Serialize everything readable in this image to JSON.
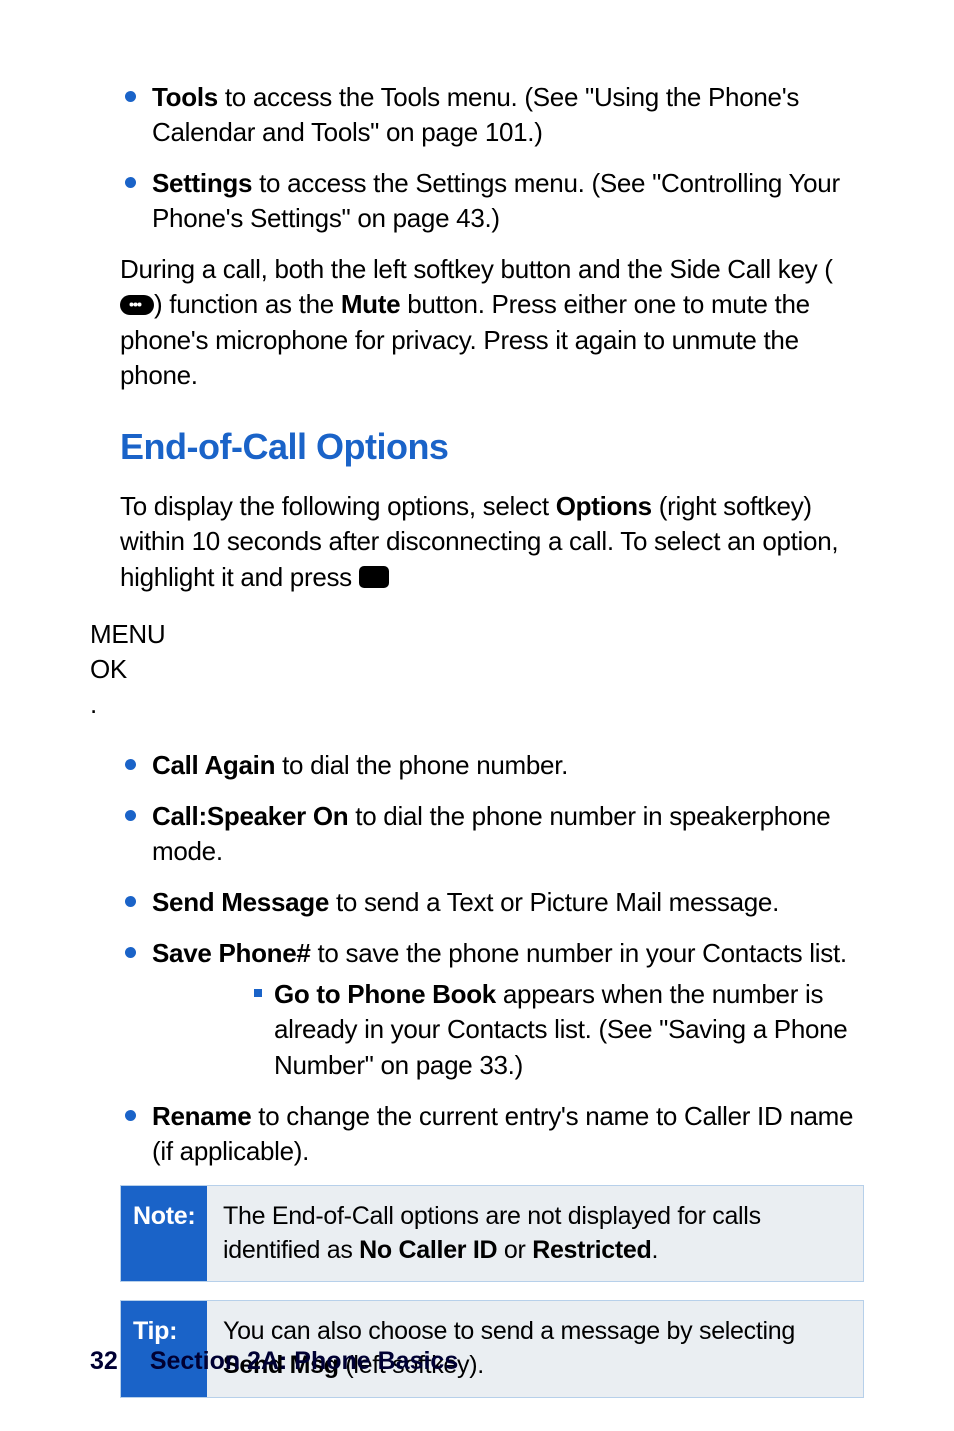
{
  "top_list": [
    {
      "title": "Tools",
      "text": " to access the Tools menu. (See \"Using the Phone's Calendar and Tools\" on page 101.)"
    },
    {
      "title": "Settings",
      "text": " to access the Settings menu. (See \"Controlling Your Phone's Settings\" on page 43.)"
    }
  ],
  "during_call": {
    "pre": "During a call, both the left softkey button and the Side Call key (",
    "post_icon": ") function as the ",
    "bold": "Mute",
    "tail": " button. Press either one to mute the phone's microphone for privacy. Press it again to unmute the phone."
  },
  "heading": "End-of-Call Options",
  "intro": {
    "pre": "To display the following options, select ",
    "options": "Options",
    "mid": " (right softkey) within 10 seconds after disconnecting a call. To select an option, highlight it and press ",
    "tail": "."
  },
  "options_list": [
    {
      "title": "Call Again",
      "text": " to dial the phone number."
    },
    {
      "title": "Call:Speaker On",
      "text": " to dial the phone number in speakerphone mode."
    },
    {
      "title": "Send Message",
      "text": " to send a Text or Picture Mail message."
    },
    {
      "title": "Save Phone#",
      "text": " to save the phone number in your Contacts list.",
      "sub": [
        {
          "title": "Go to Phone Book",
          "text": " appears when the number is already in your Contacts list. (See \"Saving a Phone Number\" on page 33.)"
        }
      ]
    },
    {
      "title": "Rename",
      "text": " to change the current entry's name to Caller ID name (if applicable)."
    }
  ],
  "note": {
    "label": "Note:",
    "pre": "The End-of-Call options are not displayed for calls identified as ",
    "b1": "No Caller ID",
    "mid": " or ",
    "b2": "Restricted",
    "tail": "."
  },
  "tip": {
    "label": "Tip:",
    "pre": "You can also choose to send a message by selecting ",
    "b1": "Send Msg",
    "tail": " (left softkey)."
  },
  "footer": {
    "page": "32",
    "section": "Section 2A: Phone Basics"
  }
}
